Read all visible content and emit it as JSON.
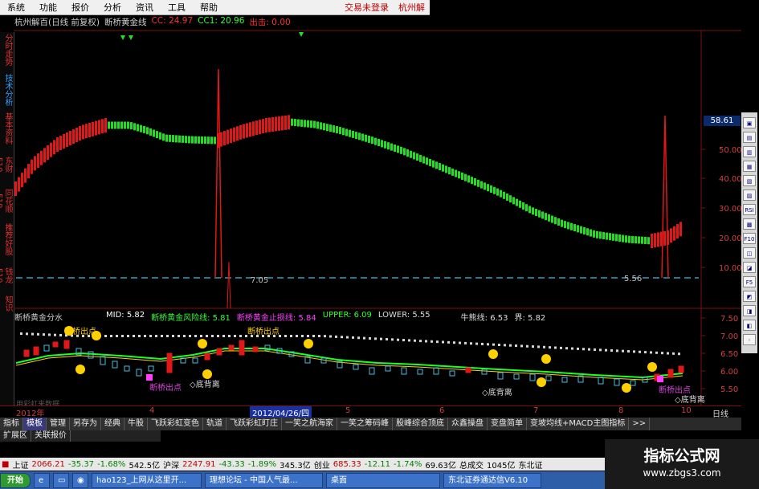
{
  "menu": {
    "items": [
      "系统",
      "功能",
      "报价",
      "分析",
      "资讯",
      "工具",
      "帮助"
    ],
    "login": "交易未登录",
    "brand": "杭州解"
  },
  "title": {
    "stock": "杭州解百(日线 前复权)",
    "indicator": "断桥黄金线",
    "cc": "CC: 24.97",
    "cc1": "CC1: 20.96",
    "chu": "出击: 0.00"
  },
  "left_tabs": [
    "分时走势",
    "技术分析",
    "基本资料",
    "东财F10",
    "同花顺F10",
    "推荐好股",
    "钱龙F10",
    "知识"
  ],
  "upper_chart": {
    "yticks": [
      "50.00",
      "40.00",
      "30.00",
      "20.00",
      "10.00"
    ],
    "current": "58.61",
    "line_left": "7.05",
    "line_right": "5.56"
  },
  "lower_header": {
    "name": "断桥黄金分水",
    "mid": "MID: 5.82",
    "fxx": "断桥黄金风险线: 5.81",
    "zsx": "断桥黄金止损线: 5.84",
    "upper": "UPPER: 6.09",
    "lower": "LOWER: 5.55",
    "nx": "牛熊线: 6.53",
    "jie": "界: 5.82"
  },
  "lower_chart": {
    "yticks": [
      "7.50",
      "7.00",
      "6.50",
      "6.00",
      "5.50"
    ],
    "annotations": [
      "断桥出点",
      "断桥出点",
      "断桥出点",
      "断桥出点",
      "◇底背离",
      "◇底背离",
      "◇底背离"
    ],
    "watermark": "用彩虹来数据"
  },
  "date_bar": {
    "left": "2012年",
    "selected": "2012/04/26/四",
    "months": [
      "4",
      "5",
      "6",
      "7",
      "8",
      "10"
    ]
  },
  "right_icons": [
    "RSI",
    "F10",
    "F5"
  ],
  "tabs": [
    "指标",
    "模板",
    "管理",
    "另存为",
    "经典",
    "牛股",
    "飞跃彩虹变色",
    "轨道",
    "飞跃彩虹盯庄",
    "一笑之航海家",
    "一笑之筹码峰",
    "股峰综合顶底",
    "众鑫操盘",
    "变盘简单",
    "变坡均线+MACD主图指标",
    ">>"
  ],
  "tabs2": [
    "扩展区",
    "关联报价"
  ],
  "period": "日线",
  "ticker": {
    "sh_label": "上证",
    "sh_val": "2066.21",
    "sh_chg": "-35.37",
    "sh_pct": "-1.68%",
    "sh_amt": "542.5亿",
    "hs_label": "沪深",
    "hs_val": "2247.91",
    "hs_chg": "-43.33",
    "hs_pct": "-1.89%",
    "hs_amt": "345.3亿",
    "cy_label": "创业",
    "cy_val": "685.33",
    "cy_chg": "-12.11",
    "cy_pct": "-1.74%",
    "cy_amt": "69.63亿",
    "total_label": "总成交",
    "total_val": "1045亿",
    "broker": "东北证"
  },
  "taskbar": {
    "start": "开始",
    "items": [
      "hao123_上网从这里开...",
      "理想论坛 - 中国人气最...",
      "桌面",
      "东北证券通达信V6.10"
    ]
  },
  "watermark": {
    "line1": "指标公式网",
    "line2": "www.zbgs3.com"
  },
  "colors": {
    "up": "#e01818",
    "down": "#20e020",
    "axis": "#7a1010",
    "dashed": "#30a0c0"
  }
}
